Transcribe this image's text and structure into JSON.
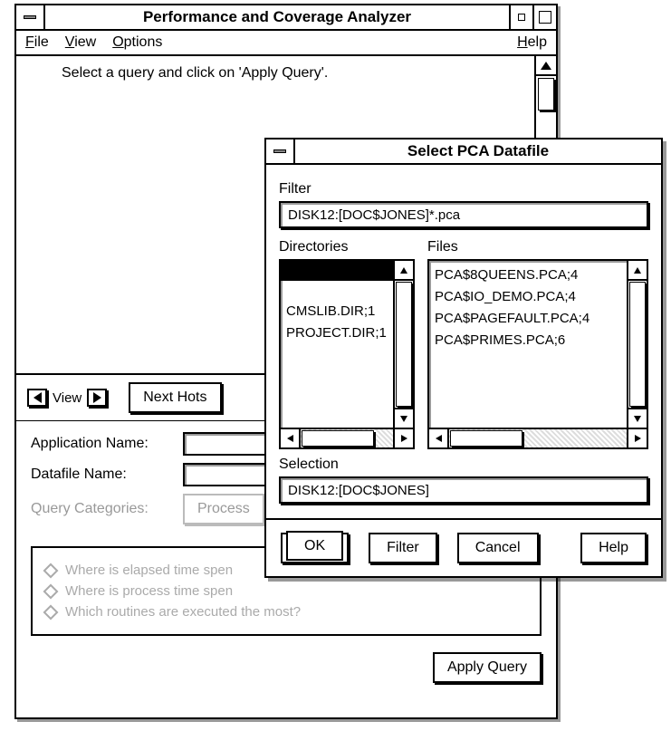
{
  "window": {
    "title": "Performance and Coverage Analyzer",
    "menu": {
      "file_html": "<span class='ul'>F</span>ile",
      "view_html": "<span class='ul'>V</span>iew",
      "options_html": "<span class='ul'>O</span>ptions",
      "help_html": "<span class='ul'>H</span>elp"
    },
    "prompt": "Select a query and click on 'Apply Query'.",
    "view_label": "View",
    "next_hotspot": "Next Hots",
    "form": {
      "app_name_label": "Application Name:",
      "datafile_label": "Datafile Name:",
      "categories_label": "Query Categories:",
      "categories_value": "Process"
    },
    "queries": [
      "Where is elapsed time spen",
      "Where is process time spen",
      "Which routines are executed the most?"
    ],
    "apply": "Apply Query"
  },
  "dialog": {
    "title": "Select PCA Datafile",
    "filter_label": "Filter",
    "filter_value": "DISK12:[DOC$JONES]*.pca",
    "directories_label": "Directories",
    "files_label": "Files",
    "directories": [
      "",
      "CMSLIB.DIR;1",
      "PROJECT.DIR;1"
    ],
    "files": [
      "PCA$8QUEENS.PCA;4",
      "PCA$IO_DEMO.PCA;4",
      "PCA$PAGEFAULT.PCA;4",
      "PCA$PRIMES.PCA;6"
    ],
    "selection_label": "Selection",
    "selection_value": "DISK12:[DOC$JONES]",
    "buttons": {
      "ok": "OK",
      "filter": "Filter",
      "cancel": "Cancel",
      "help": "Help"
    }
  }
}
